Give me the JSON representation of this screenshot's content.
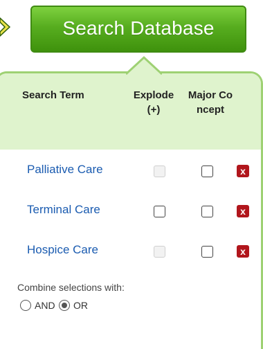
{
  "search_button": {
    "label": "Search Database"
  },
  "table": {
    "headers": {
      "term": "Search Term",
      "explode": "Explode (+)",
      "major": "Major Concept"
    },
    "rows": [
      {
        "term": "Palliative Care",
        "explode_checked": false,
        "explode_enabled": false,
        "major_checked": false,
        "remove_label": "x"
      },
      {
        "term": "Terminal Care",
        "explode_checked": false,
        "explode_enabled": true,
        "major_checked": false,
        "remove_label": "x"
      },
      {
        "term": "Hospice Care",
        "explode_checked": false,
        "explode_enabled": false,
        "major_checked": false,
        "remove_label": "x"
      }
    ]
  },
  "combine": {
    "label": "Combine selections with:",
    "options": [
      {
        "label": "AND",
        "selected": false
      },
      {
        "label": "OR",
        "selected": true
      }
    ]
  },
  "colors": {
    "button_green": "#57ad1f",
    "panel_border": "#9ed173",
    "header_fill": "#dff3cd",
    "link_blue": "#1a5bb0",
    "remove_red": "#b1161c",
    "arrow_yellow": "#e9e24a"
  },
  "icons": {
    "left_arrow": "chevron-right-icon",
    "remove": "remove-x-icon"
  }
}
